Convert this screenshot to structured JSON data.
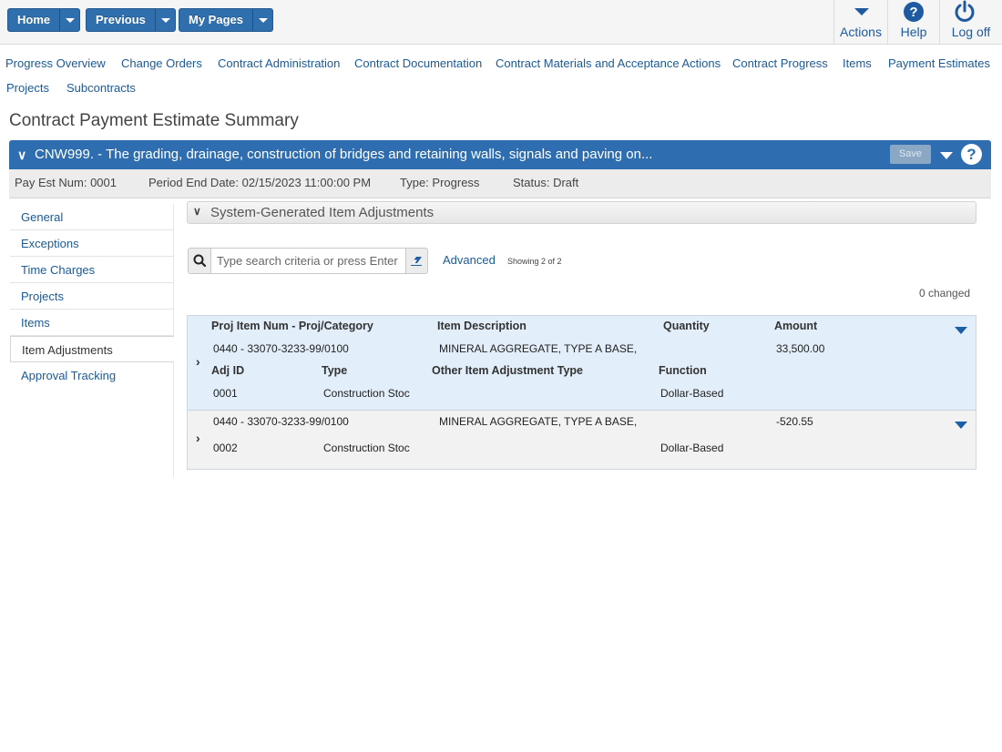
{
  "topbar": {
    "home_label": "Home",
    "previous_label": "Previous",
    "mypages_label": "My Pages",
    "actions_label": "Actions",
    "help_label": "Help",
    "logoff_label": "Log off"
  },
  "nav": {
    "links": [
      "Progress Overview",
      "Change Orders",
      "Contract Administration",
      "Contract Documentation",
      "Contract Materials and Acceptance Actions",
      "Contract Progress",
      "Items",
      "Payment Estimates",
      "Projects",
      "Subcontracts"
    ]
  },
  "page": {
    "title": "Contract Payment Estimate Summary"
  },
  "contract": {
    "title": "CNW999. - The grading, drainage, construction of bridges and retaining walls, signals and paving on...",
    "save_label": "Save",
    "help_glyph": "?"
  },
  "info": {
    "pay_est_num": "Pay Est Num: 0001",
    "period_end": "Period End Date: 02/15/2023 11:00:00 PM",
    "type": "Type: Progress",
    "status": "Status: Draft"
  },
  "leftmenu": {
    "items": [
      "General",
      "Exceptions",
      "Time Charges",
      "Projects",
      "Items",
      "Item Adjustments",
      "Approval Tracking"
    ],
    "active": "Item Adjustments"
  },
  "section": {
    "title": "System-Generated Item Adjustments"
  },
  "search": {
    "placeholder": "Type search criteria or press Enter",
    "value": "",
    "advanced_label": "Advanced",
    "showing": "Showing 2 of 2",
    "changed": "0 changed"
  },
  "grid": {
    "headers": {
      "proj_item": "Proj Item Num - Proj/Category",
      "description": "Item Description",
      "quantity": "Quantity",
      "amount": "Amount",
      "adj_id": "Adj ID",
      "type": "Type",
      "other_type": "Other Item Adjustment Type",
      "function": "Function"
    },
    "rows": [
      {
        "proj_item": "0440 - 33070-3233-99/0100",
        "description": "MINERAL AGGREGATE, TYPE A BASE,",
        "quantity": "",
        "amount": "33,500.00",
        "adj_id": "0001",
        "type": "Construction Stoc",
        "other_type": "",
        "function": "Dollar-Based"
      },
      {
        "proj_item": "0440 - 33070-3233-99/0100",
        "description": "MINERAL AGGREGATE, TYPE A BASE,",
        "quantity": "",
        "amount": "-520.55",
        "adj_id": "0002",
        "type": "Construction Stoc",
        "other_type": "",
        "function": "Dollar-Based"
      }
    ]
  },
  "colors": {
    "primary": "#2d6db0",
    "link": "#1b5a97",
    "selected_row": "#e2eef9"
  }
}
